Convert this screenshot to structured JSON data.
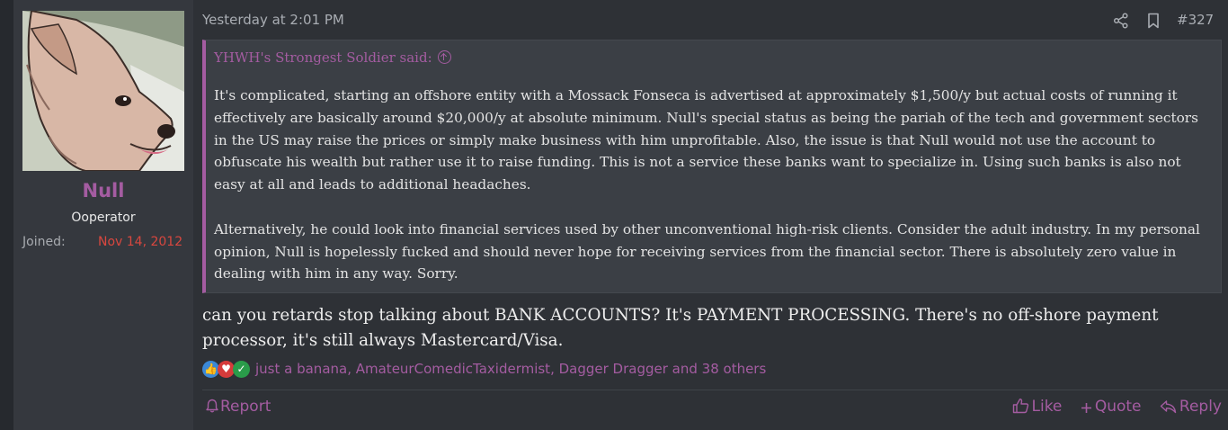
{
  "user": {
    "name": "Null",
    "title": "Ooperator",
    "joined_label": "Joined:",
    "joined_date": "Nov 14, 2012"
  },
  "post": {
    "date": "Yesterday at 2:01 PM",
    "number": "#327",
    "quote": {
      "author": "YHWH's Strongest Soldier said:",
      "paragraphs": [
        "It's complicated, starting an offshore entity with a Mossack Fonseca is advertised at approximately $1,500/y but actual costs of running it effectively are basically around $20,000/y at absolute minimum. Null's special status as being the pariah of the tech and government sectors in the US may raise the prices or simply make business with him unprofitable. Also, the issue is that Null would not use the account to obfuscate his wealth but rather use it to raise funding. This is not a service these banks want to specialize in. Using such banks is also not easy at all and leads to additional headaches.",
        "Alternatively, he could look into financial services used by other unconventional high-risk clients. Consider the adult industry. In my personal opinion, Null is hopelessly fucked and should never hope for receiving services from the financial sector. There is absolutely zero value in dealing with him in any way. Sorry."
      ]
    },
    "message": "can you retards stop talking about BANK ACCOUNTS? It's PAYMENT PROCESSING. There's no off-shore payment processor, it's still always Mastercard/Visa.",
    "reactions_text": "just a banana, AmateurComedicTaxidermist, Dagger Dragger and 38 others",
    "reaction_icons": [
      "like-icon",
      "love-icon",
      "agree-icon"
    ]
  },
  "footer": {
    "report": "Report",
    "like": "Like",
    "quote": "Quote",
    "reply": "Reply"
  },
  "colors": {
    "accent": "#a45ca1",
    "joined_date": "#d9473f",
    "background": "#2e3136"
  }
}
